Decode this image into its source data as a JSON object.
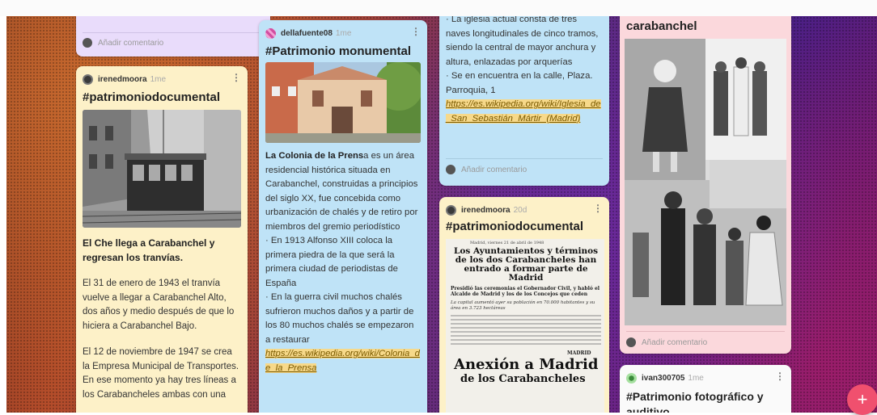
{
  "cards": {
    "lav_top": {
      "comment": "Añadir comentario"
    },
    "irene_tram": {
      "author": "irenedmoora",
      "time": "1me",
      "title": "#patrimoniodocumental",
      "heading": "El Che llega a Carabanchel y regresan los tranvías.",
      "p1": "El 31 de enero de 1943 el tranvía vuelve a llegar a Carabanchel Alto, dos años y medio después de que lo hiciera a Carabanchel Bajo.",
      "p2": "El 12 de noviembre de 1947 se crea la Empresa Municipal de Transportes. En ese momento ya hay tres líneas a los Carabancheles ambas con una"
    },
    "della": {
      "author": "dellafuente08",
      "time": "1me",
      "title": "#Patrimonio monumental",
      "bold_lead": "La Colonia de la Prens",
      "lead_rest": "a es un área residencial histórica situada en Carabanchel, construidas a principios del siglo XX, fue concebida como urbanización de chalés y de retiro por miembros del gremio periodístico",
      "b1": "· En 1913 Alfonso XIII coloca la primera piedra de la que será la primera ciudad de periodistas de España",
      "b2": "· En la guerra civil muchos chalés sufrieron muchos daños y a partir de los 80 muchos chalés se empezaron a restaurar",
      "link": "https://es.wikipedia.org/wiki/Colonia_de_la_Prensa"
    },
    "iglesia": {
      "l1": "· La iglesia actual consta de tres naves longitudinales de cinco tramos, siendo la central de mayor anchura y altura, enlazadas por arquerías",
      "l2": "· Se en encuentra en la calle, Plaza. Parroquia, 1",
      "link": "https://es.wikipedia.org/wiki/Iglesia_de_San_Sebastián_Mártir_(Madrid)",
      "comment": "Añadir comentario"
    },
    "irene_news": {
      "author": "irenedmoora",
      "time": "20d",
      "title": "#patrimoniodocumental",
      "news_top_date": "Madrid, viernes 21 de abril de 1948",
      "news_headline": "Los Ayuntamientos y términos de los dos Carabancheles han entrado a formar parte de Madrid",
      "news_sub": "Presidió las ceremonias el Gobernador Civil, y habló el Alcalde de Madrid y los de los Concejos que ceden",
      "news_sub2": "La capital aumentó ayer su población en 70.000 habitantes y su área en 3.723 hectáreas",
      "news2_tag": "MADRID",
      "news2_headline_a": "Anexión a Madrid",
      "news2_headline_b": "de los Carabancheles"
    },
    "carab": {
      "title": "carabanchel",
      "comment": "Añadir comentario"
    },
    "ivan": {
      "author": "ivan300705",
      "time": "1me",
      "title": "#Patrimonio fotográfico y auditivo"
    }
  },
  "fab_label": "+",
  "icons": {
    "kebab": "⋮"
  }
}
